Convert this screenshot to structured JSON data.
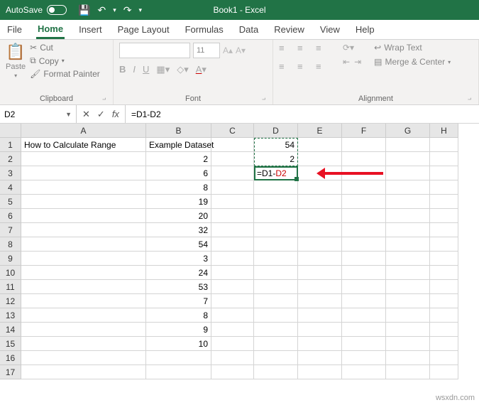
{
  "title": "Book1 - Excel",
  "autosave": {
    "label": "AutoSave"
  },
  "qat": {
    "save": "💾",
    "undo": "↶",
    "redo": "↷"
  },
  "tabs": [
    "File",
    "Home",
    "Insert",
    "Page Layout",
    "Formulas",
    "Data",
    "Review",
    "View",
    "Help"
  ],
  "activeTab": "Home",
  "ribbon": {
    "clipboard": {
      "label": "Clipboard",
      "paste": "Paste",
      "cut": "Cut",
      "copy": "Copy",
      "painter": "Format Painter"
    },
    "font": {
      "label": "Font",
      "size": "11",
      "b": "B",
      "i": "I",
      "u": "U"
    },
    "alignment": {
      "label": "Alignment",
      "wrap": "Wrap Text",
      "merge": "Merge & Center"
    }
  },
  "nameBox": "D2",
  "formula": "=D1-D2",
  "columns": [
    "A",
    "B",
    "C",
    "D",
    "E",
    "F",
    "G",
    "H"
  ],
  "rows": [
    {
      "n": 1,
      "A": "How to Calculate Range",
      "B": "Example Dataset",
      "D": "54"
    },
    {
      "n": 2,
      "A": "",
      "B": "2",
      "D": "2"
    },
    {
      "n": 3,
      "A": "",
      "B": "6",
      "D": ""
    },
    {
      "n": 4,
      "A": "",
      "B": "8"
    },
    {
      "n": 5,
      "A": "",
      "B": "19"
    },
    {
      "n": 6,
      "A": "",
      "B": "20"
    },
    {
      "n": 7,
      "A": "",
      "B": "32"
    },
    {
      "n": 8,
      "A": "",
      "B": "54"
    },
    {
      "n": 9,
      "A": "",
      "B": "3"
    },
    {
      "n": 10,
      "A": "",
      "B": "24"
    },
    {
      "n": 11,
      "A": "",
      "B": "53"
    },
    {
      "n": 12,
      "A": "",
      "B": "7"
    },
    {
      "n": 13,
      "A": "",
      "B": "8"
    },
    {
      "n": 14,
      "A": "",
      "B": "9"
    },
    {
      "n": 15,
      "A": "",
      "B": "10"
    },
    {
      "n": 16,
      "A": "",
      "B": ""
    },
    {
      "n": 17,
      "A": "",
      "B": ""
    }
  ],
  "edit": {
    "prefix": "=D1-",
    "suffix": "D2"
  },
  "watermark": "wsxdn.com"
}
